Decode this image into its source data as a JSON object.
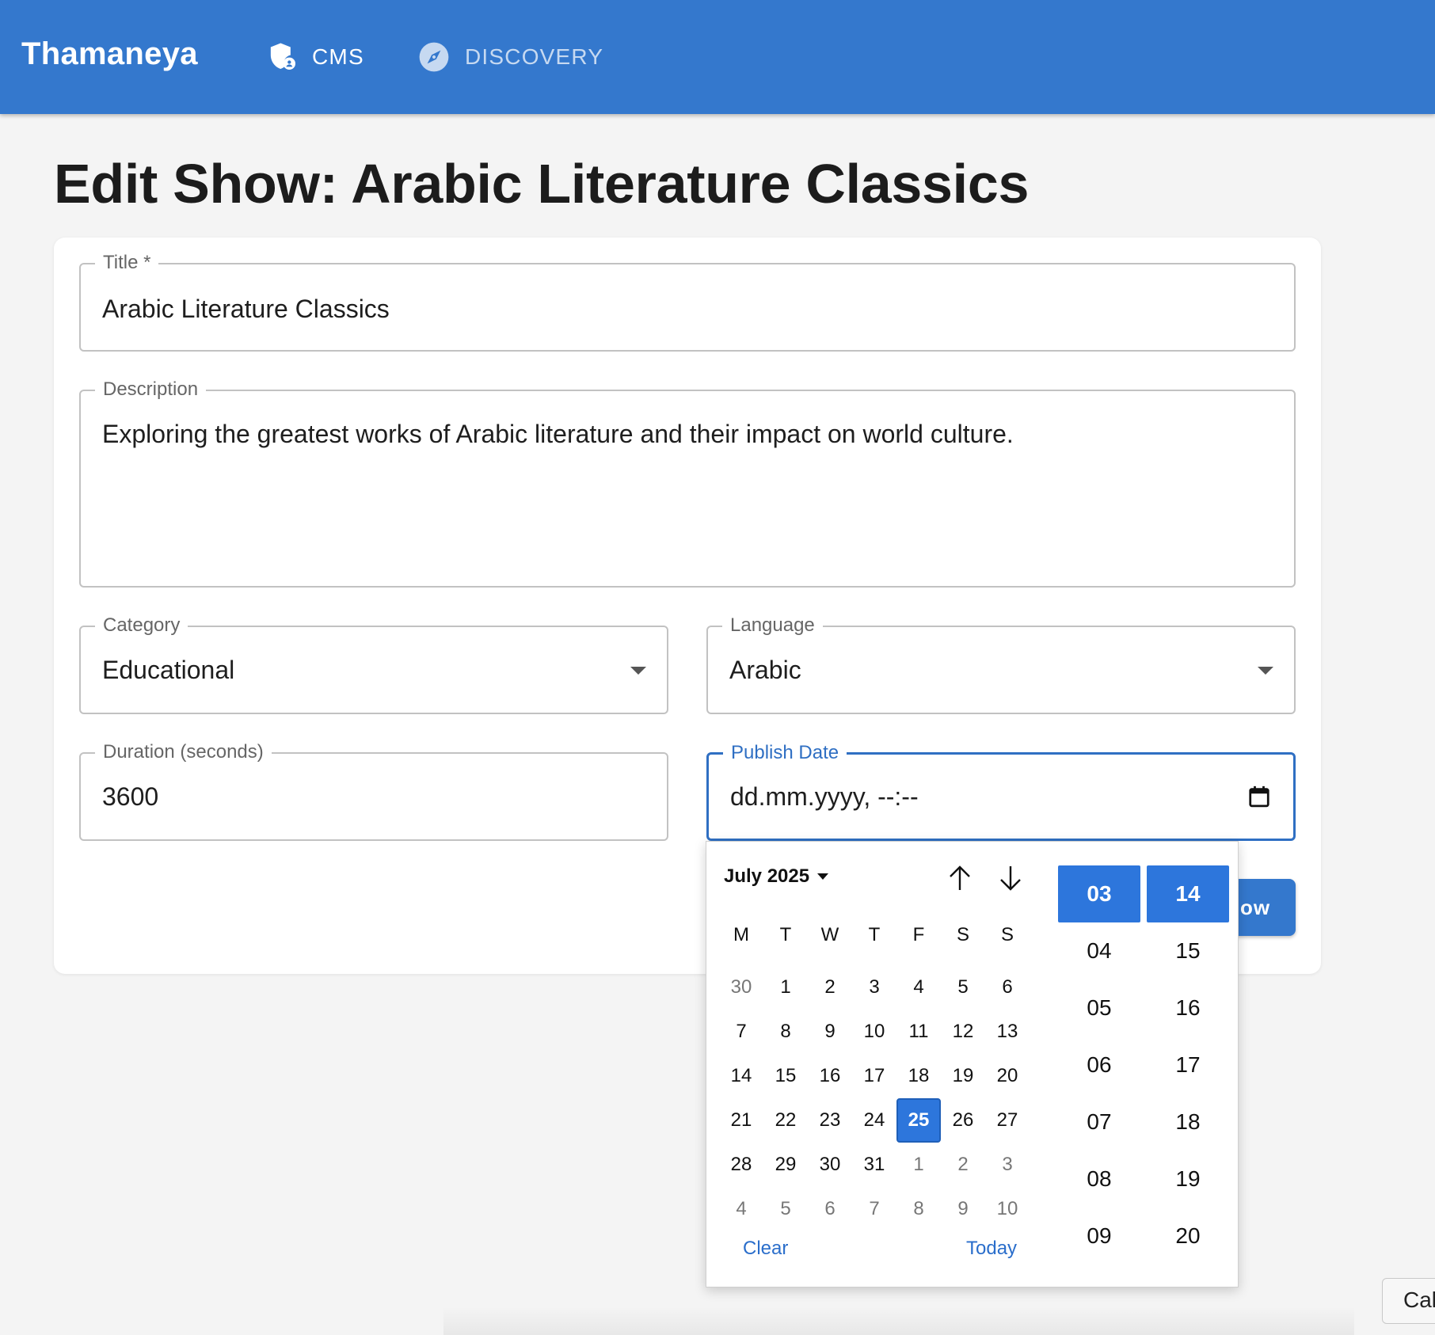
{
  "appbar": {
    "brand": "Thamaneya",
    "nav": [
      {
        "label": "CMS",
        "icon": "shield-user-icon",
        "active": true
      },
      {
        "label": "DISCOVERY",
        "icon": "compass-icon",
        "active": false
      }
    ]
  },
  "page": {
    "title": "Edit Show: Arabic Literature Classics"
  },
  "form": {
    "title": {
      "label": "Title *",
      "value": "Arabic Literature Classics"
    },
    "description": {
      "label": "Description",
      "value": "Exploring the greatest works of Arabic literature and their impact on world culture."
    },
    "category": {
      "label": "Category",
      "value": "Educational"
    },
    "language": {
      "label": "Language",
      "value": "Arabic"
    },
    "duration": {
      "label": "Duration (seconds)",
      "value": "3600"
    },
    "publish_date": {
      "label": "Publish Date",
      "value": "dd.mm.yyyy, --:--"
    },
    "save_button_visible": "ow"
  },
  "datepicker": {
    "month_label": "July 2025",
    "weekdays": [
      "M",
      "T",
      "W",
      "T",
      "F",
      "S",
      "S"
    ],
    "weeks": [
      [
        "30",
        "1",
        "2",
        "3",
        "4",
        "5",
        "6"
      ],
      [
        "7",
        "8",
        "9",
        "10",
        "11",
        "12",
        "13"
      ],
      [
        "14",
        "15",
        "16",
        "17",
        "18",
        "19",
        "20"
      ],
      [
        "21",
        "22",
        "23",
        "24",
        "25",
        "26",
        "27"
      ],
      [
        "28",
        "29",
        "30",
        "31",
        "1",
        "2",
        "3"
      ],
      [
        "4",
        "5",
        "6",
        "7",
        "8",
        "9",
        "10"
      ]
    ],
    "selected_day": "25",
    "clear_label": "Clear",
    "today_label": "Today",
    "hours": [
      "03",
      "04",
      "05",
      "06",
      "07",
      "08",
      "09"
    ],
    "minutes": [
      "14",
      "15",
      "16",
      "17",
      "18",
      "19",
      "20"
    ],
    "selected_hour": "03",
    "selected_minute": "14"
  },
  "partial_button": {
    "label": "Cal"
  },
  "colors": {
    "appbar": "#3478cd",
    "accent": "#2d76dc",
    "focus": "#2f6fc3",
    "background": "#f4f4f4"
  }
}
